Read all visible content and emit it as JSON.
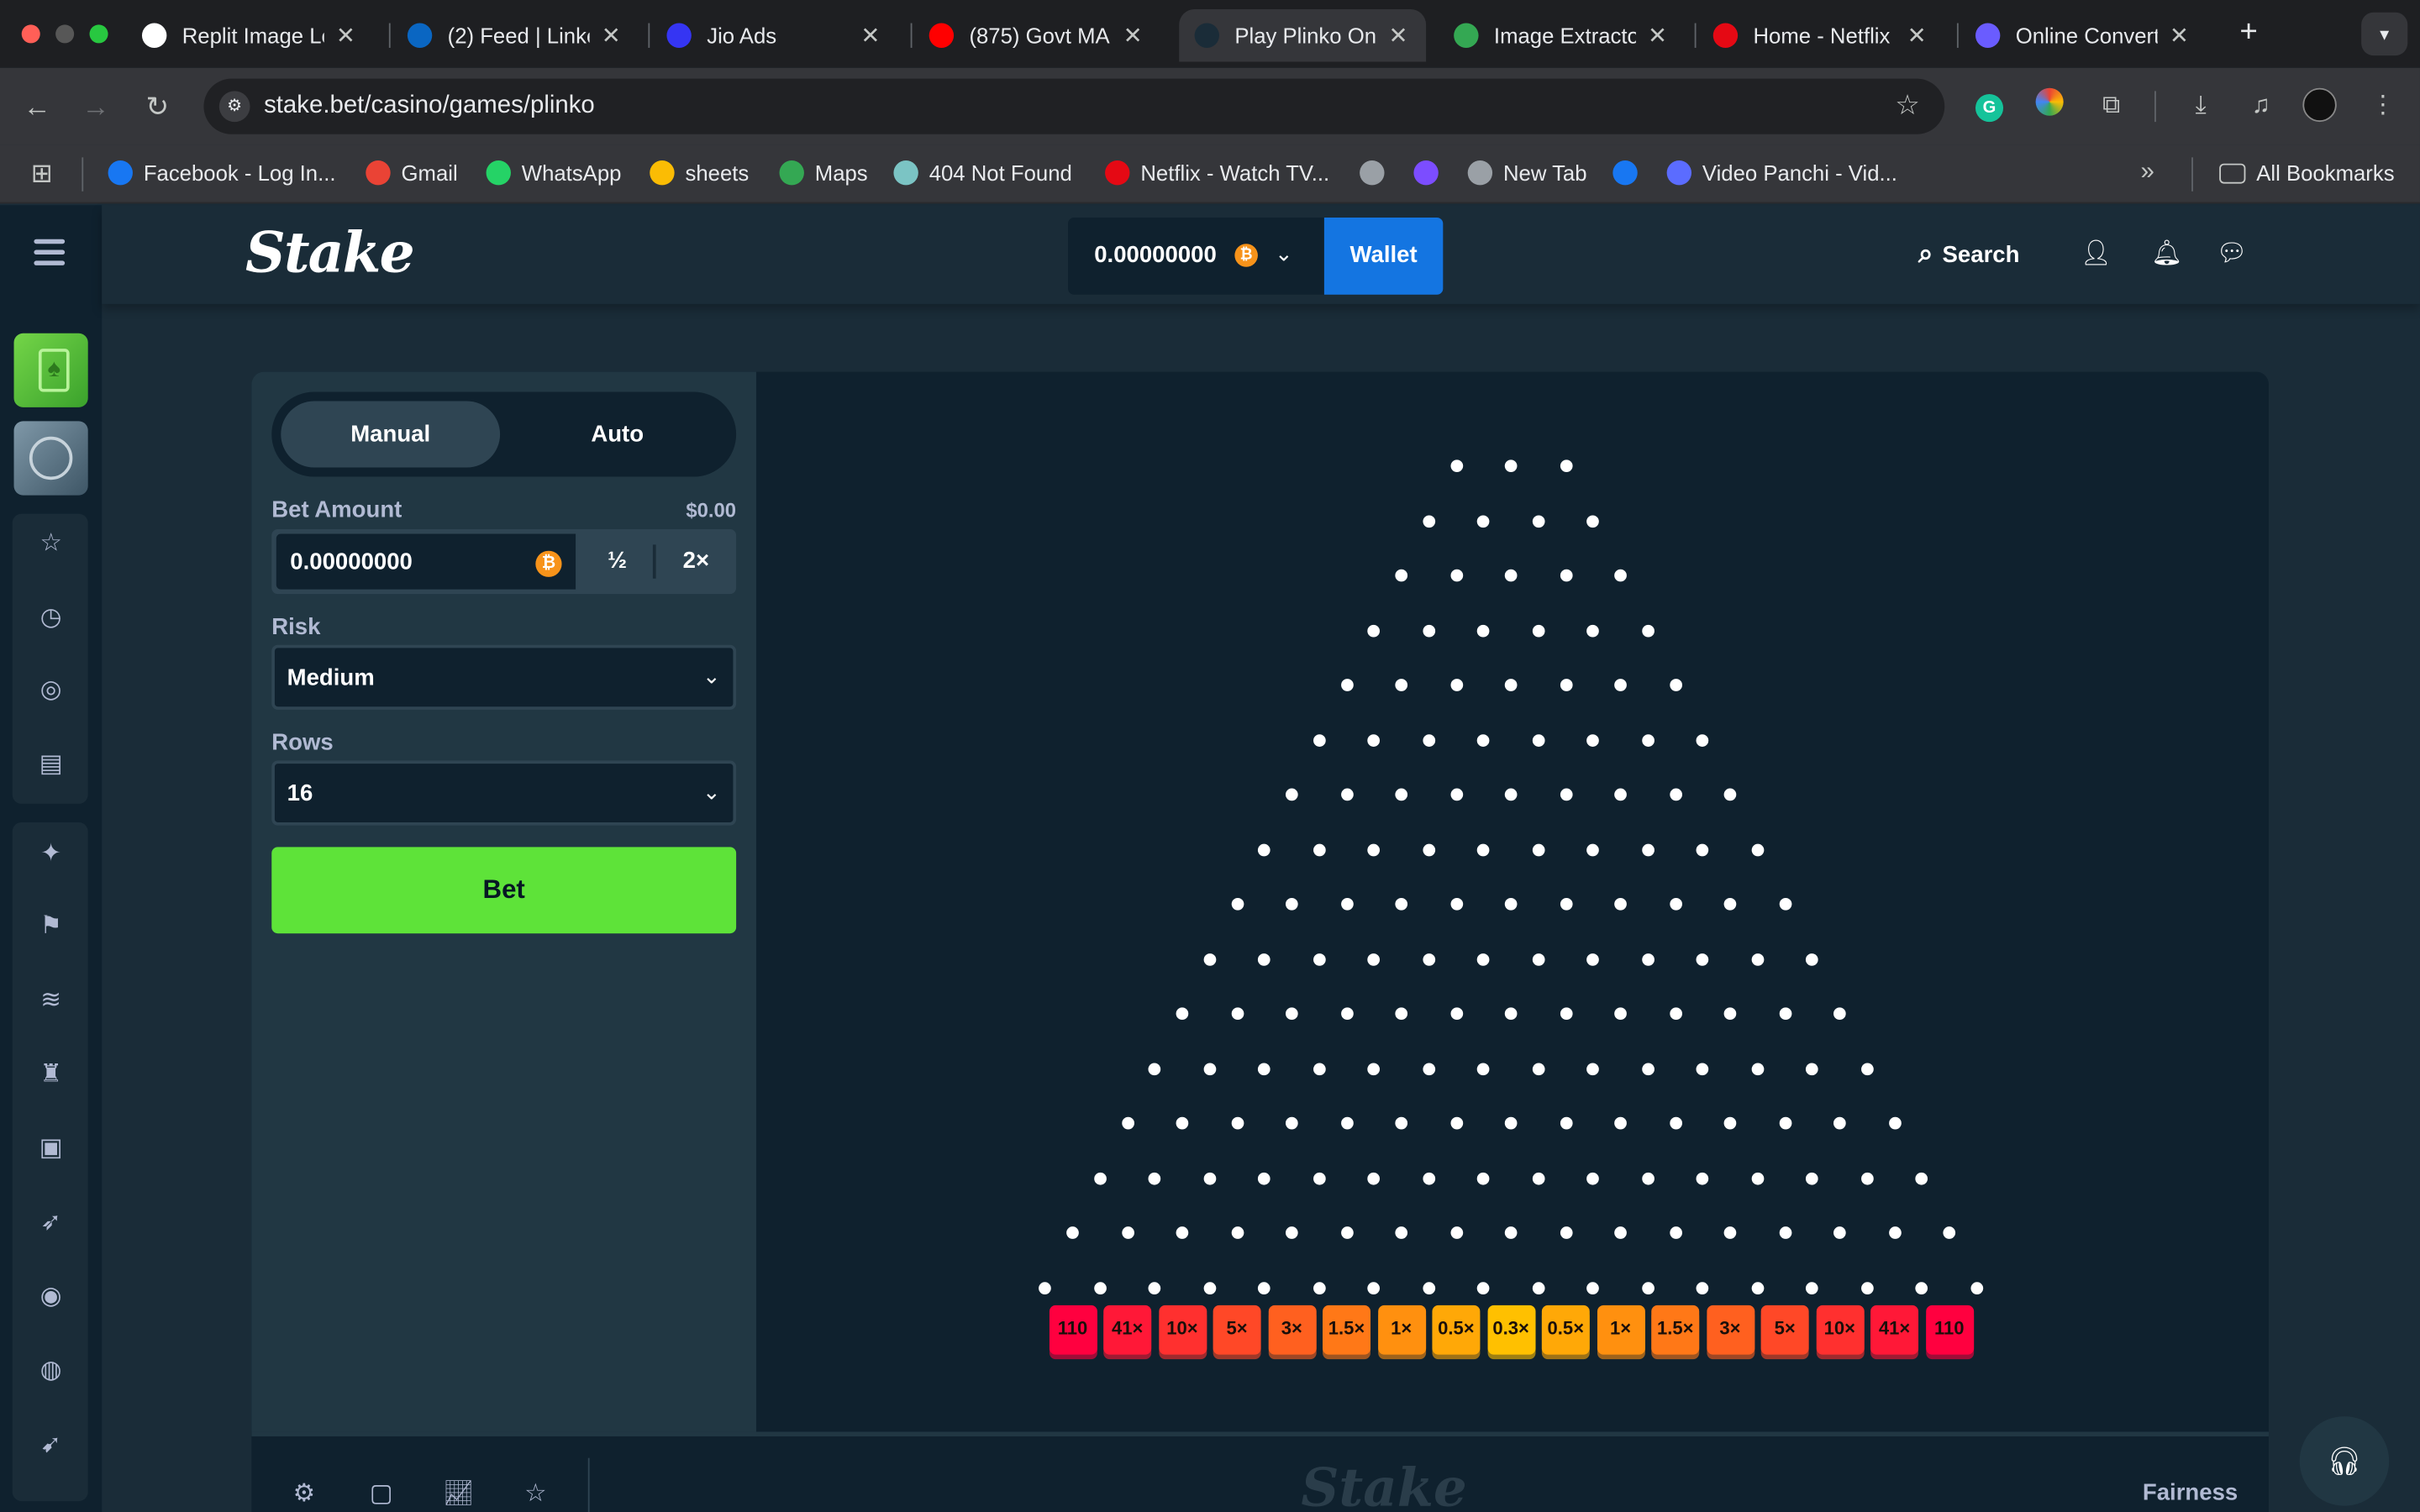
{
  "browser": {
    "tabs": [
      {
        "title": "Replit Image Lo",
        "fav": "openai-icon",
        "color": "#ffffff"
      },
      {
        "title": "(2) Feed | Linke",
        "fav": "linkedin-icon",
        "color": "#0a66c2"
      },
      {
        "title": "Jio Ads",
        "fav": "jio-icon",
        "color": "#3535f3"
      },
      {
        "title": "(875) Govt MA",
        "fav": "youtube-icon",
        "color": "#ff0000"
      },
      {
        "title": "Play Plinko Onl",
        "fav": "stake-icon",
        "color": "#1a2c38",
        "active": true
      },
      {
        "title": "Image Extracto",
        "fav": "image-icon",
        "color": "#34a853"
      },
      {
        "title": "Home - Netflix",
        "fav": "netflix-icon",
        "color": "#e50914"
      },
      {
        "title": "Online Convert",
        "fav": "converter-icon",
        "color": "#6a5cff"
      }
    ],
    "url": "stake.bet/casino/games/plinko",
    "bookmarks": [
      {
        "label": "Facebook - Log In...",
        "fav": "facebook-icon",
        "color": "#1877f2"
      },
      {
        "label": "Gmail",
        "fav": "gmail-icon",
        "color": "#ea4335"
      },
      {
        "label": "WhatsApp",
        "fav": "whatsapp-icon",
        "color": "#25d366"
      },
      {
        "label": "sheets",
        "fav": "drive-icon",
        "color": "#fbbc04"
      },
      {
        "label": "Maps",
        "fav": "maps-icon",
        "color": "#34a853"
      },
      {
        "label": "404 Not Found",
        "fav": "replit-icon",
        "color": "#7bc4c4"
      },
      {
        "label": "Netflix - Watch TV...",
        "fav": "netflix-icon",
        "color": "#e50914"
      },
      {
        "label": "",
        "fav": "globe-icon",
        "color": "#9aa0a6"
      },
      {
        "label": "",
        "fav": "sparkle-icon",
        "color": "#7c4dff"
      },
      {
        "label": "New Tab",
        "fav": "globe-icon",
        "color": "#9aa0a6"
      },
      {
        "label": "",
        "fav": "facebook-icon",
        "color": "#1877f2"
      },
      {
        "label": "Video Panchi - Vid...",
        "fav": "canva-icon",
        "color": "#5b6cff"
      }
    ],
    "all_bookmarks": "All Bookmarks"
  },
  "app": {
    "logo": "Stake",
    "balance": "0.00000000",
    "currency_icon": "bitcoin-icon",
    "wallet": "Wallet",
    "search": "Search"
  },
  "controls": {
    "mode_manual": "Manual",
    "mode_auto": "Auto",
    "bet_amount_label": "Bet Amount",
    "bet_amount_usd": "$0.00",
    "bet_amount": "0.00000000",
    "half": "½",
    "double": "2×",
    "risk_label": "Risk",
    "risk": "Medium",
    "rows_label": "Rows",
    "rows": "16",
    "bet_button": "Bet"
  },
  "board": {
    "rows": 16,
    "multipliers": [
      "110",
      "41×",
      "10×",
      "5×",
      "3×",
      "1.5×",
      "1×",
      "0.5×",
      "0.3×",
      "0.5×",
      "1×",
      "1.5×",
      "3×",
      "5×",
      "10×",
      "41×",
      "110"
    ],
    "slot_colors": [
      "#ff003f",
      "#ff1837",
      "#ff302f",
      "#ff4827",
      "#ff601f",
      "#ff7817",
      "#ff900f",
      "#ffa807",
      "#ffc000",
      "#ffa807",
      "#ff900f",
      "#ff7817",
      "#ff601f",
      "#ff4827",
      "#ff302f",
      "#ff1837",
      "#ff003f"
    ]
  },
  "footer": {
    "logo": "Stake",
    "fairness": "Fairness"
  }
}
